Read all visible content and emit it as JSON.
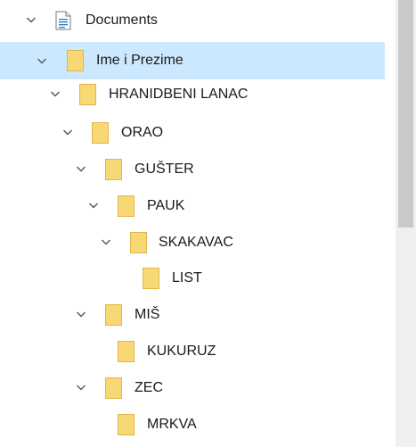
{
  "tree": {
    "items": [
      {
        "label": "Documents",
        "level": 0,
        "expanded": true,
        "icon": "documents-icon",
        "selected": false
      },
      {
        "label": "Ime i Prezime",
        "level": 1,
        "expanded": true,
        "icon": "folder-icon",
        "selected": true
      },
      {
        "label": "HRANIDBENI LANAC",
        "level": 2,
        "expanded": true,
        "icon": "folder-icon",
        "selected": false
      },
      {
        "label": "ORAO",
        "level": 3,
        "expanded": true,
        "icon": "folder-icon",
        "selected": false
      },
      {
        "label": "GUŠTER",
        "level": 4,
        "expanded": true,
        "icon": "folder-icon",
        "selected": false
      },
      {
        "label": "PAUK",
        "level": 5,
        "expanded": true,
        "icon": "folder-icon",
        "selected": false
      },
      {
        "label": "SKAKAVAC",
        "level": 6,
        "expanded": true,
        "icon": "folder-icon",
        "selected": false
      },
      {
        "label": "LIST",
        "level": 7,
        "expanded": false,
        "icon": "folder-icon",
        "selected": false
      },
      {
        "label": "MIŠ",
        "level": 4,
        "expanded": true,
        "icon": "folder-icon",
        "selected": false
      },
      {
        "label": "KUKURUZ",
        "level": 5,
        "expanded": false,
        "icon": "folder-icon",
        "selected": false
      },
      {
        "label": "ZEC",
        "level": 4,
        "expanded": true,
        "icon": "folder-icon",
        "selected": false
      },
      {
        "label": "MRKVA",
        "level": 5,
        "expanded": false,
        "icon": "folder-icon",
        "selected": false
      }
    ]
  },
  "colors": {
    "selected_background": "#cce8ff",
    "folder_fill": "#f8d775",
    "folder_edge": "#e0b64a",
    "chevron": "#555555"
  }
}
